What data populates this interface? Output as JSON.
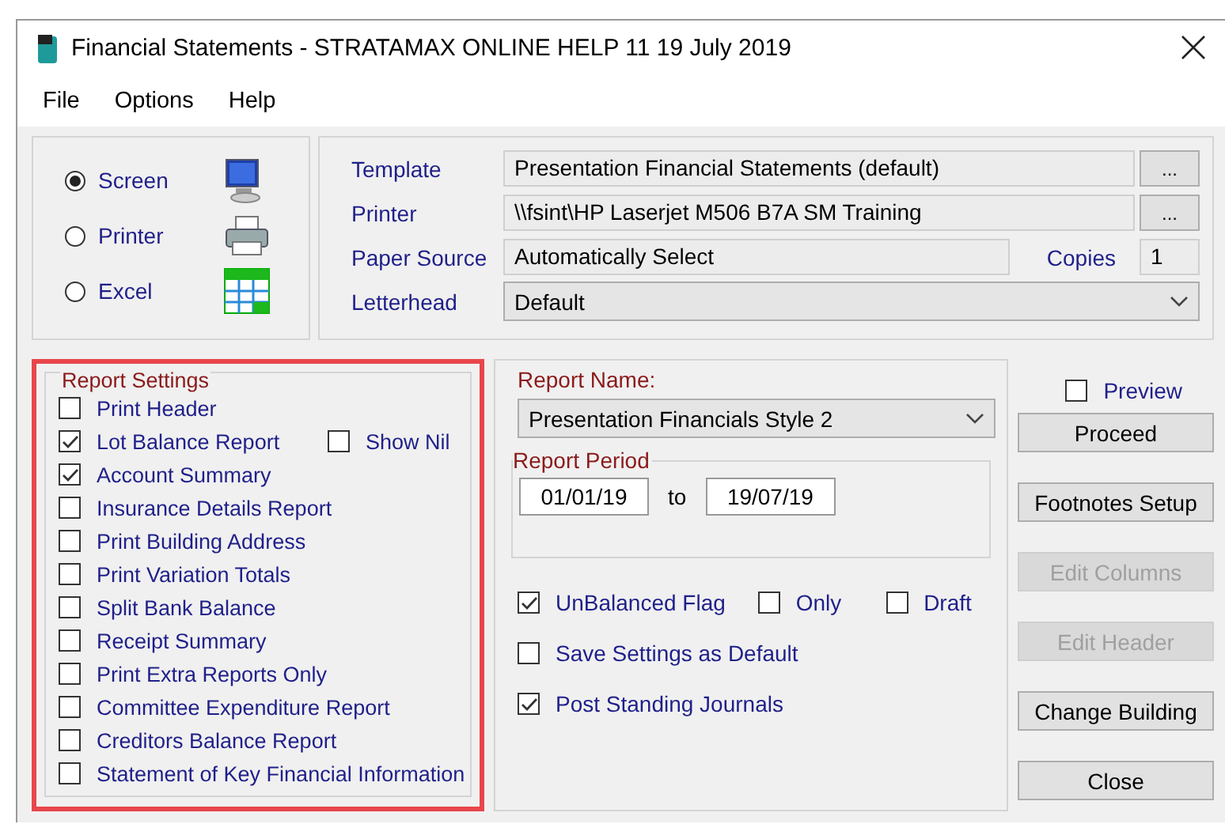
{
  "window": {
    "title": "Financial Statements - STRATAMAX ONLINE HELP 11 19 July 2019"
  },
  "menu": [
    "File",
    "Options",
    "Help"
  ],
  "output": [
    {
      "label": "Screen",
      "selected": true,
      "kind": "monitor"
    },
    {
      "label": "Printer",
      "selected": false,
      "kind": "printer"
    },
    {
      "label": "Excel",
      "selected": false,
      "kind": "spreadsheet"
    }
  ],
  "template": {
    "label": "Template",
    "value": "Presentation Financial Statements (default)",
    "browse": "..."
  },
  "printer": {
    "label": "Printer",
    "value": "\\\\fsint\\HP Laserjet M506 B7A SM Training",
    "browse": "..."
  },
  "paper_source": {
    "label": "Paper Source",
    "value": "Automatically Select"
  },
  "copies": {
    "label": "Copies",
    "value": "1"
  },
  "letterhead": {
    "label": "Letterhead",
    "value": "Default"
  },
  "report_settings": {
    "title": "Report Settings",
    "show_nil": {
      "label": "Show Nil",
      "checked": false
    },
    "items": [
      {
        "label": "Print Header",
        "checked": false
      },
      {
        "label": "Lot Balance Report",
        "checked": true
      },
      {
        "label": "Account Summary",
        "checked": true
      },
      {
        "label": "Insurance Details Report",
        "checked": false
      },
      {
        "label": "Print Building Address",
        "checked": false
      },
      {
        "label": "Print Variation Totals",
        "checked": false
      },
      {
        "label": "Split Bank Balance",
        "checked": false
      },
      {
        "label": "Receipt Summary",
        "checked": false
      },
      {
        "label": "Print Extra Reports Only",
        "checked": false
      },
      {
        "label": "Committee Expenditure Report",
        "checked": false
      },
      {
        "label": "Creditors Balance Report",
        "checked": false
      },
      {
        "label": "Statement of Key Financial Information",
        "checked": false
      }
    ]
  },
  "report_name": {
    "label": "Report Name:",
    "value": "Presentation Financials Style 2"
  },
  "report_period": {
    "title": "Report Period",
    "from": "01/01/19",
    "separator": "to",
    "to": "19/07/19"
  },
  "flags": [
    {
      "label": "UnBalanced Flag",
      "checked": true
    },
    {
      "label": "Only",
      "checked": false
    },
    {
      "label": "Draft",
      "checked": false
    }
  ],
  "options": [
    {
      "label": "Save Settings as Default",
      "checked": false
    },
    {
      "label": "Post Standing Journals",
      "checked": true
    }
  ],
  "preview": {
    "label": "Preview",
    "checked": false
  },
  "buttons": [
    {
      "label": "Proceed",
      "disabled": false
    },
    {
      "label": "Footnotes Setup",
      "disabled": false
    },
    {
      "label": "Edit Columns",
      "disabled": true
    },
    {
      "label": "Edit Header",
      "disabled": true
    },
    {
      "label": "Change Building",
      "disabled": false
    },
    {
      "label": "Close",
      "disabled": false
    }
  ]
}
